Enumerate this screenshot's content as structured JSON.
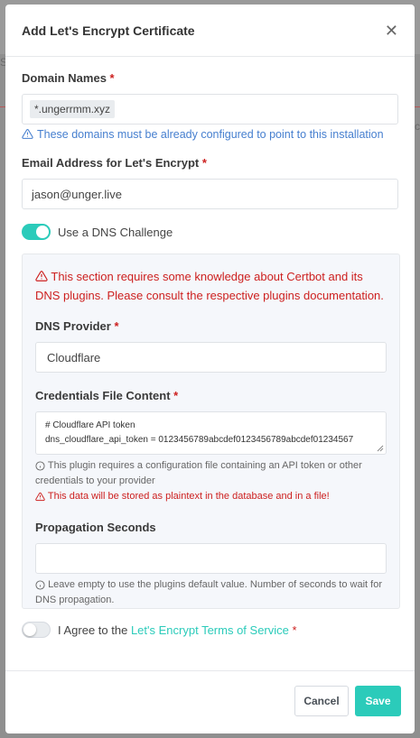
{
  "modal": {
    "title": "Add Let's Encrypt Certificate",
    "close_icon": "close-icon"
  },
  "domains": {
    "label": "Domain Names",
    "required_mark": "*",
    "tag": "*.ungerrmm.xyz",
    "hint": "These domains must be already configured to point to this installation"
  },
  "email": {
    "label": "Email Address for Let's Encrypt",
    "required_mark": "*",
    "value": "jason@unger.live"
  },
  "dns_challenge": {
    "label": "Use a DNS Challenge",
    "enabled": true
  },
  "dns_panel": {
    "warning": "This section requires some knowledge about Certbot and its DNS plugins. Please consult the respective plugins documentation.",
    "provider_label": "DNS Provider",
    "provider_required": "*",
    "provider_value": "Cloudflare",
    "credentials_label": "Credentials File Content",
    "credentials_required": "*",
    "credentials_line1": "# Cloudflare API token",
    "credentials_line2": "dns_cloudflare_api_token = 0123456789abcdef0123456789abcdef01234567",
    "credentials_note": "This plugin requires a configuration file containing an API token or other credentials to your provider",
    "credentials_warning": "This data will be stored as plaintext in the database and in a file!",
    "propagation_label": "Propagation Seconds",
    "propagation_value": "",
    "propagation_note": "Leave empty to use the plugins default value. Number of seconds to wait for DNS propagation."
  },
  "agree": {
    "prefix": "I Agree to the ",
    "link": "Let's Encrypt Terms of Service",
    "required_mark": "*",
    "enabled": false
  },
  "footer": {
    "cancel_label": "Cancel",
    "save_label": "Save"
  },
  "backdrop": {
    "left_text": "SS",
    "right_text": "c"
  },
  "colors": {
    "accent": "#2bcbba",
    "danger": "#cd201f",
    "info": "#467fcf"
  }
}
